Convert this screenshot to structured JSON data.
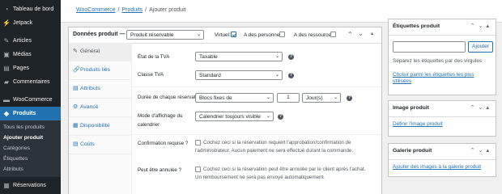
{
  "sidebar": {
    "items": [
      {
        "label": "Tableau de bord",
        "icon": "dashboard-icon",
        "glyph": "◔"
      },
      {
        "label": "Jetpack",
        "icon": "jetpack-icon",
        "glyph": "⚡"
      },
      {
        "label": "Articles",
        "icon": "pushpin-icon",
        "glyph": "✎"
      },
      {
        "label": "Médias",
        "icon": "media-icon",
        "glyph": "▣"
      },
      {
        "label": "Pages",
        "icon": "pages-icon",
        "glyph": "▤"
      },
      {
        "label": "Commentaires",
        "icon": "comments-icon",
        "glyph": "▰"
      },
      {
        "label": "WooCommerce",
        "icon": "woocommerce-icon",
        "glyph": "▬"
      },
      {
        "label": "Produits",
        "icon": "products-icon",
        "glyph": "◈"
      }
    ],
    "submenu": [
      "Tous les produits",
      "Ajouter produit",
      "Catégories",
      "Étiquettes",
      "Attributs"
    ],
    "after": {
      "label": "Réservations",
      "icon": "calendar-icon",
      "glyph": "▦"
    }
  },
  "breadcrumb": {
    "woocommerce": "WooCommerce",
    "produits": "Produits",
    "sep": "/",
    "current": "Ajouter produit"
  },
  "product_data": {
    "title": "Données produit —",
    "type_select": "Produit réservable",
    "virtual_label": "Virtuel:",
    "virtual_checked": true,
    "persons_label": "A des personnes:",
    "resources_label": "A des ressources:",
    "tabs": [
      {
        "label": "Général",
        "glyph": "✎"
      },
      {
        "label": "Produits liés",
        "glyph": "🔗"
      },
      {
        "label": "Attributs",
        "glyph": "▤"
      },
      {
        "label": "Avancé",
        "glyph": "⚙"
      },
      {
        "label": "Disponibilité",
        "glyph": "▦"
      },
      {
        "label": "Coûts",
        "glyph": "▤"
      }
    ],
    "fields": {
      "tax_status": {
        "label": "État de la TVA",
        "value": "Taxable"
      },
      "tax_class": {
        "label": "Classe TVA",
        "value": "Standard"
      },
      "duration": {
        "label": "Durée de chaque réservation",
        "type": "Blocs fixes de",
        "qty": "1",
        "unit": "Jour(s)"
      },
      "calendar": {
        "label_1": "Mode d'affichage du",
        "label_2": "calendrier",
        "value": "Calendrier toujours visible"
      },
      "confirm": {
        "label": "Confirmation requise ?",
        "desc_1": "Cochez ceci si la réservation requiert l'approbation/confirmation de",
        "desc_2": "l'administrateur. Aucun paiement ne sera effectué durant la commande."
      },
      "cancel": {
        "label": "Peut être annulée ?",
        "desc_1": "Cochez ceci si la réservation peut être annulée par le client après l'achat.",
        "desc_2": "Un remboursement ne sera pas envoyé automatiquement."
      }
    }
  },
  "tags_box": {
    "title": "Étiquettes produit",
    "input_placeholder": "",
    "button": "Ajouter",
    "help": "Séparez les étiquettes par des virgules",
    "link_1": "Choisir parmi les étiquettes les plus",
    "link_2": "utilisées"
  },
  "image_box": {
    "title": "Image produit",
    "link": "Définir l'image produit"
  },
  "gallery_box": {
    "title": "Galerie produit",
    "link": "Ajouter des images à la galerie produit"
  },
  "controls": {
    "up": "⌃",
    "down": "⌄",
    "toggle": "▴",
    "help": "?"
  },
  "colors": {
    "admin_dark": "#1d2327",
    "accent": "#2271b1",
    "bg": "#f0f0f1"
  }
}
